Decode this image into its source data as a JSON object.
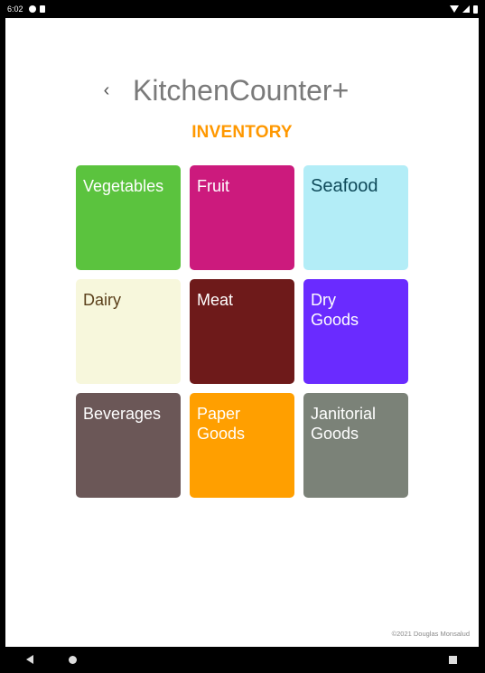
{
  "status_bar": {
    "time": "6:02"
  },
  "header": {
    "back_label": "‹",
    "title": "KitchenCounter+"
  },
  "section": {
    "title": "INVENTORY"
  },
  "tiles": [
    {
      "label": "Vegetables",
      "color": "#5bc33e"
    },
    {
      "label": "Fruit",
      "color": "#cc1a7d"
    },
    {
      "label": "Seafood",
      "color": "#b3edf7"
    },
    {
      "label": "Dairy",
      "color": "#f7f7dc"
    },
    {
      "label": "Meat",
      "color": "#6e1a1a"
    },
    {
      "label": "Dry\nGoods",
      "color": "#6a2bff"
    },
    {
      "label": "Beverages",
      "color": "#6b5757"
    },
    {
      "label": "Paper\nGoods",
      "color": "#ff9f00"
    },
    {
      "label": "Janitorial\nGoods",
      "color": "#7b8278"
    }
  ],
  "footer": {
    "credit": "©2021 Douglas Monsalud"
  },
  "colors": {
    "accent": "#ff9800",
    "title_gray": "#7a7a7a"
  }
}
